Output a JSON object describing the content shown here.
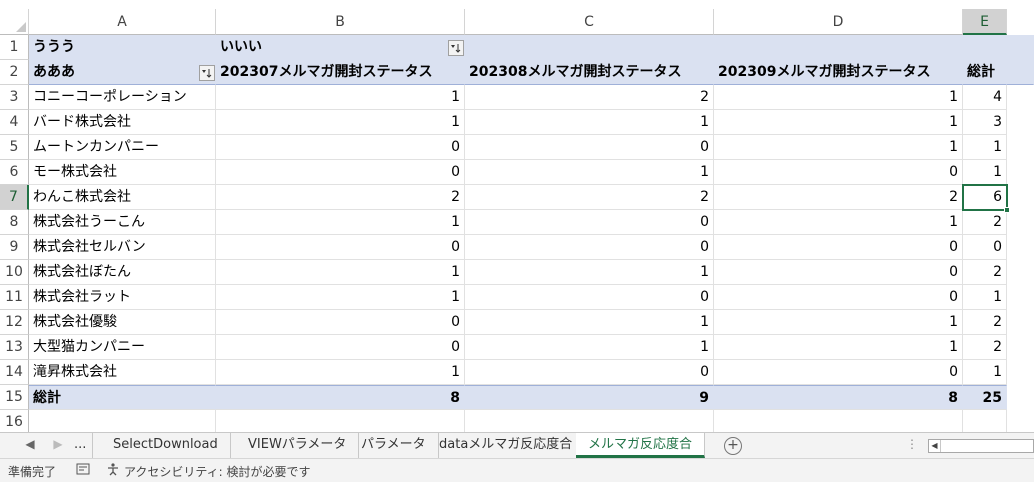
{
  "columns": [
    "A",
    "B",
    "C",
    "D",
    "E"
  ],
  "rows": [
    "1",
    "2",
    "3",
    "4",
    "5",
    "6",
    "7",
    "8",
    "9",
    "10",
    "11",
    "12",
    "13",
    "14",
    "15",
    "16"
  ],
  "pivot": {
    "r1": {
      "a": "ううう",
      "b": "いいい"
    },
    "r2": {
      "a": "あああ",
      "b": "202307メルマガ開封ステータス",
      "c": "202308メルマガ開封ステータス",
      "d": "202309メルマガ開封ステータス",
      "e": "総計"
    },
    "data": [
      {
        "name": "コニーコーポレーション",
        "b": "1",
        "c": "2",
        "d": "1",
        "e": "4"
      },
      {
        "name": "バード株式会社",
        "b": "1",
        "c": "1",
        "d": "1",
        "e": "3"
      },
      {
        "name": "ムートンカンパニー",
        "b": "0",
        "c": "0",
        "d": "1",
        "e": "1"
      },
      {
        "name": "モー株式会社",
        "b": "0",
        "c": "1",
        "d": "0",
        "e": "1"
      },
      {
        "name": "わんこ株式会社",
        "b": "2",
        "c": "2",
        "d": "2",
        "e": "6"
      },
      {
        "name": "株式会社うーこん",
        "b": "1",
        "c": "0",
        "d": "1",
        "e": "2"
      },
      {
        "name": "株式会社セルバン",
        "b": "0",
        "c": "0",
        "d": "0",
        "e": "0"
      },
      {
        "name": "株式会社ぼたん",
        "b": "1",
        "c": "1",
        "d": "0",
        "e": "2"
      },
      {
        "name": "株式会社ラット",
        "b": "1",
        "c": "0",
        "d": "0",
        "e": "1"
      },
      {
        "name": "株式会社優駿",
        "b": "0",
        "c": "1",
        "d": "1",
        "e": "2"
      },
      {
        "name": "大型猫カンパニー",
        "b": "0",
        "c": "1",
        "d": "1",
        "e": "2"
      },
      {
        "name": "滝昇株式会社",
        "b": "1",
        "c": "0",
        "d": "0",
        "e": "1"
      }
    ],
    "total": {
      "a": "総計",
      "b": "8",
      "c": "9",
      "d": "8",
      "e": "25"
    }
  },
  "filter_icon": "filter-sort-icon",
  "active_cell": "E7",
  "tabs": {
    "ellipsis": "...",
    "items": [
      "SelectDownload",
      "VIEWパラメータ",
      "パラメータ",
      "dataメルマガ反応度合",
      "メルマガ反応度合"
    ],
    "active_index": 4
  },
  "status": {
    "ready": "準備完了",
    "accessibility": "アクセシビリティ: 検討が必要です"
  },
  "colors": {
    "accent": "#217346",
    "pivot_band": "#dae1f1"
  }
}
